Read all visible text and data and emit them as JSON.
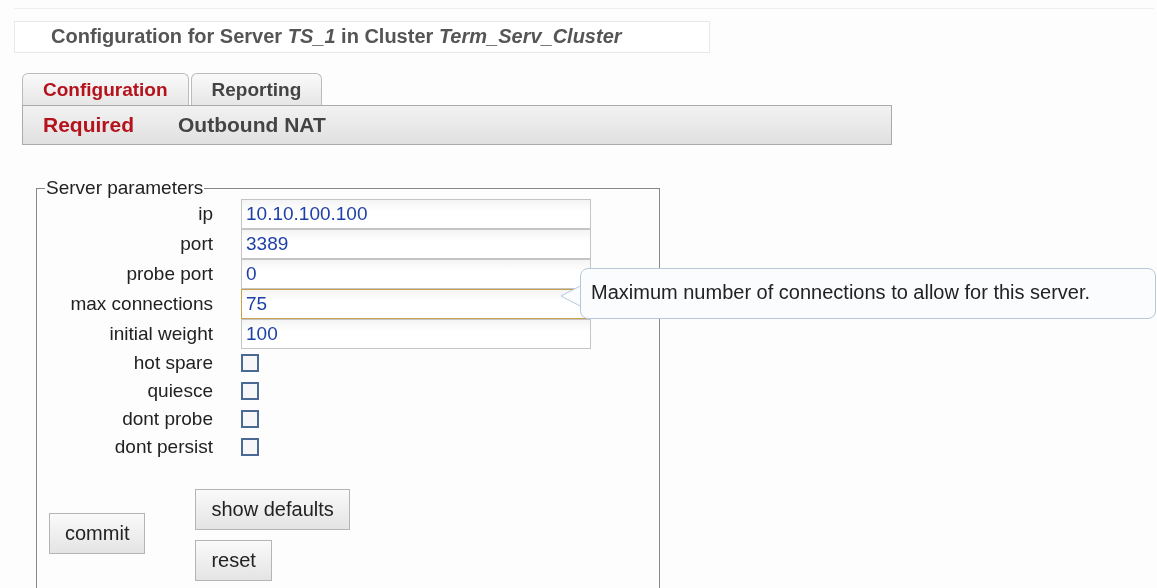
{
  "heading": "Configuration for Server *TS_1* in Cluster *Term_Serv_Cluster*",
  "tabs": [
    {
      "label": "Configuration",
      "selected": true
    },
    {
      "label": "Reporting",
      "selected": false
    }
  ],
  "subtabs": [
    {
      "label": "Required",
      "selected": true
    },
    {
      "label": "Outbound NAT",
      "selected": false
    }
  ],
  "fieldset": {
    "legend": "Server parameters",
    "fields": [
      {
        "kind": "text",
        "label": "ip",
        "value": "10.10.100.100",
        "focused": false
      },
      {
        "kind": "text",
        "label": "port",
        "value": "3389",
        "focused": false
      },
      {
        "kind": "text",
        "label": "probe port",
        "value": "0",
        "focused": false
      },
      {
        "kind": "text",
        "label": "max connections",
        "value": "75",
        "focused": true
      },
      {
        "kind": "text",
        "label": "initial weight",
        "value": "100",
        "focused": false
      },
      {
        "kind": "checkbox",
        "label": "hot spare",
        "checked": false
      },
      {
        "kind": "checkbox",
        "label": "quiesce",
        "checked": false
      },
      {
        "kind": "checkbox",
        "label": "dont probe",
        "checked": false
      },
      {
        "kind": "checkbox",
        "label": "dont persist",
        "checked": false
      }
    ],
    "buttons": {
      "commit": "commit",
      "show_defaults": "show defaults",
      "reset": "reset"
    }
  },
  "tooltip": "Maximum number of connections to allow for this server."
}
